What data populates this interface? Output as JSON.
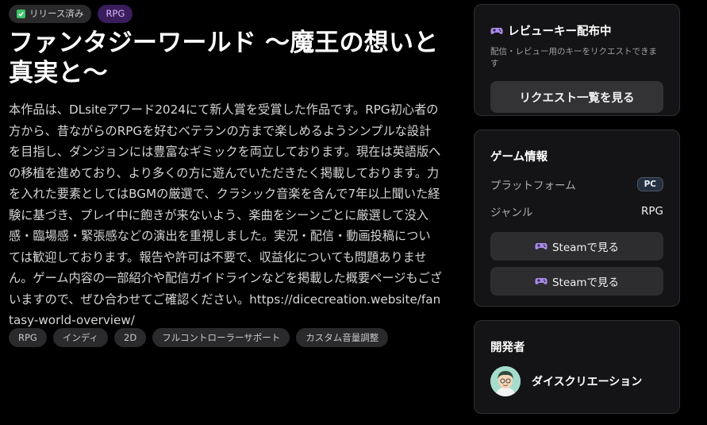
{
  "badges": {
    "released": "リリース済み",
    "genre": "RPG"
  },
  "title": "ファンタジーワールド 〜魔王の想いと真実と〜",
  "description": "本作品は、DLsiteアワード2024にて新人賞を受賞した作品です。RPG初心者の方から、昔ながらのRPGを好むベテランの方まで楽しめるようシンプルな設計を目指し、ダンジョンには豊富なギミックを両立しております。現在は英語版への移植を進めており、より多くの方に遊んでいただきたく掲載しております。力を入れた要素としてはBGMの厳選で、クラシック音楽を含んで7年以上聞いた経験に基づき、プレイ中に飽きが来ないよう、楽曲をシーンごとに厳選して没入感・臨場感・緊張感などの演出を重視しました。実況・配信・動画投稿については歓迎しております。報告や許可は不要で、収益化についても問題ありません。ゲーム内容の一部紹介や配信ガイドラインなどを掲載した概要ページもございますので、ぜひ合わせてご確認ください。https://dicecreation.website/fantasy-world-overview/",
  "tags": [
    "RPG",
    "インディ",
    "2D",
    "フルコントローラーサポート",
    "カスタム音量調整"
  ],
  "review_card": {
    "title": "レビューキー配布中",
    "subtitle": "配信・レビュー用のキーをリクエストできます",
    "button": "リクエスト一覧を見る"
  },
  "game_info": {
    "title": "ゲーム情報",
    "platform_label": "プラットフォーム",
    "platform_value": "PC",
    "genre_label": "ジャンル",
    "genre_value": "RPG",
    "steam_button_1": "Steamで見る",
    "steam_button_2": "Steamで見る"
  },
  "developer": {
    "title": "開発者",
    "name": "ダイスクリエーション"
  },
  "colors": {
    "background": "#000000",
    "card": "#141416",
    "genre_badge": "#3a1d5c",
    "check": "#3cc36a"
  },
  "icons": {
    "controller": "gamepad-icon",
    "check": "check-icon"
  }
}
